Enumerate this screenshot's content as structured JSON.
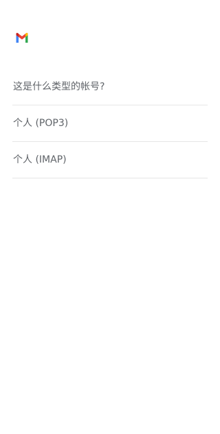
{
  "app": {
    "logo_icon": "gmail-logo-icon",
    "colors": {
      "red": "#EA4335",
      "blue": "#4285F4",
      "green": "#34A853",
      "yellow": "#FBBC05",
      "text": "#5f6368",
      "divider": "#e6e6e6"
    }
  },
  "prompt": {
    "question": "这是什么类型的帐号?"
  },
  "options": [
    {
      "label": "个人 (POP3)"
    },
    {
      "label": "个人 (IMAP)"
    }
  ]
}
